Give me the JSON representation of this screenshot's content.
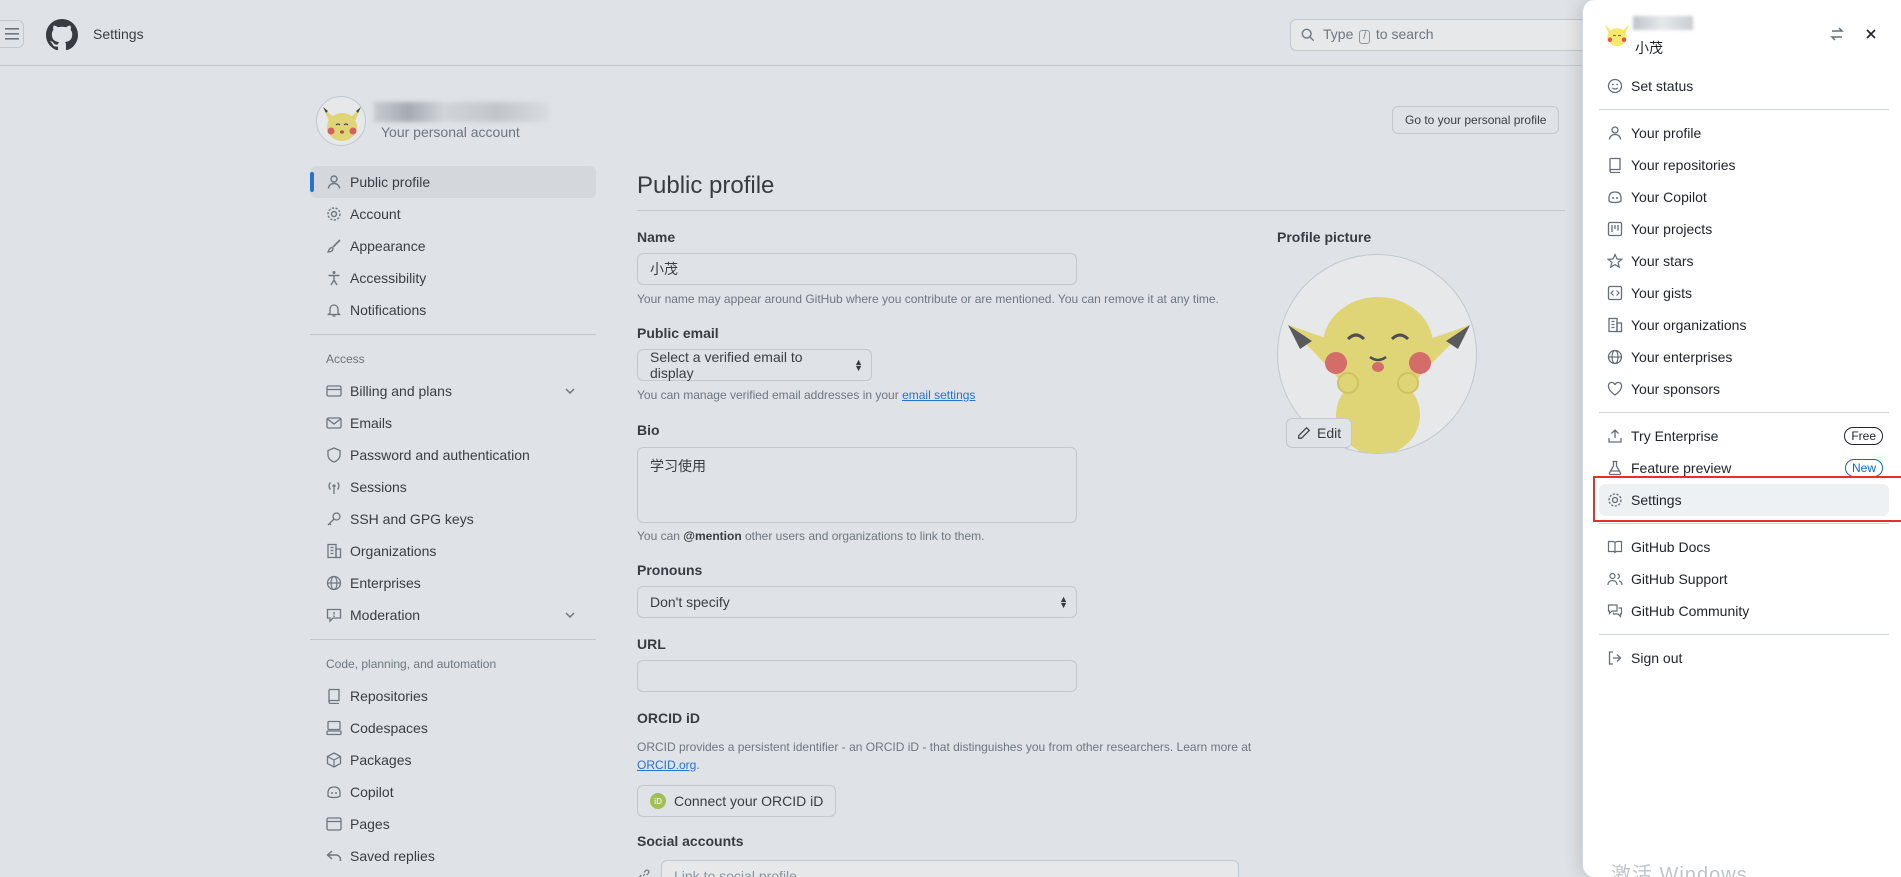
{
  "header": {
    "title": "Settings",
    "search_prefix": "Type",
    "search_key": "/",
    "search_suffix": "to search"
  },
  "account": {
    "subtitle": "Your personal account",
    "goto_profile": "Go to your personal profile"
  },
  "nav": {
    "items_top": [
      {
        "label": "Public profile"
      },
      {
        "label": "Account"
      },
      {
        "label": "Appearance"
      },
      {
        "label": "Accessibility"
      },
      {
        "label": "Notifications"
      }
    ],
    "access_group": "Access",
    "items_access": [
      {
        "label": "Billing and plans"
      },
      {
        "label": "Emails"
      },
      {
        "label": "Password and authentication"
      },
      {
        "label": "Sessions"
      },
      {
        "label": "SSH and GPG keys"
      },
      {
        "label": "Organizations"
      },
      {
        "label": "Enterprises"
      },
      {
        "label": "Moderation"
      }
    ],
    "code_group": "Code, planning, and automation",
    "items_code": [
      {
        "label": "Repositories"
      },
      {
        "label": "Codespaces"
      },
      {
        "label": "Packages"
      },
      {
        "label": "Copilot"
      },
      {
        "label": "Pages"
      },
      {
        "label": "Saved replies"
      }
    ]
  },
  "profile": {
    "heading": "Public profile",
    "name_label": "Name",
    "name_value": "小茂",
    "name_hint": "Your name may appear around GitHub where you contribute or are mentioned. You can remove it at any time.",
    "email_label": "Public email",
    "email_value": "Select a verified email to display",
    "email_hint_prefix": "You can manage verified email addresses in your",
    "email_hint_link": "email settings",
    "bio_label": "Bio",
    "bio_value": "学习使用",
    "bio_hint_prefix": "You can",
    "bio_hint_mention": "@mention",
    "bio_hint_suffix": "other users and organizations to link to them.",
    "pronouns_label": "Pronouns",
    "pronouns_value": "Don't specify",
    "url_label": "URL",
    "url_value": "",
    "orcid_label": "ORCID iD",
    "orcid_hint": "ORCID provides a persistent identifier - an ORCID iD - that distinguishes you from other researchers. Learn more at",
    "orcid_link": "ORCID.org",
    "orcid_button": "Connect your ORCID iD",
    "social_label": "Social accounts",
    "social_placeholder": "Link to social profile",
    "picture_label": "Profile picture",
    "edit_button": "Edit"
  },
  "drawer": {
    "name": "小茂",
    "set_status": "Set status",
    "group1": [
      {
        "label": "Your profile"
      },
      {
        "label": "Your repositories"
      },
      {
        "label": "Your Copilot"
      },
      {
        "label": "Your projects"
      },
      {
        "label": "Your stars"
      },
      {
        "label": "Your gists"
      },
      {
        "label": "Your organizations"
      },
      {
        "label": "Your enterprises"
      },
      {
        "label": "Your sponsors"
      }
    ],
    "try_enterprise": "Try Enterprise",
    "try_enterprise_badge": "Free",
    "feature_preview": "Feature preview",
    "feature_preview_badge": "New",
    "settings": "Settings",
    "group3": [
      {
        "label": "GitHub Docs"
      },
      {
        "label": "GitHub Support"
      },
      {
        "label": "GitHub Community"
      }
    ],
    "sign_out": "Sign out",
    "watermark": "激活 Windows"
  },
  "colors": {
    "accent": "#0969da",
    "highlight_box": "#e5302a",
    "pikachu_yellow": "#f7e76b"
  }
}
